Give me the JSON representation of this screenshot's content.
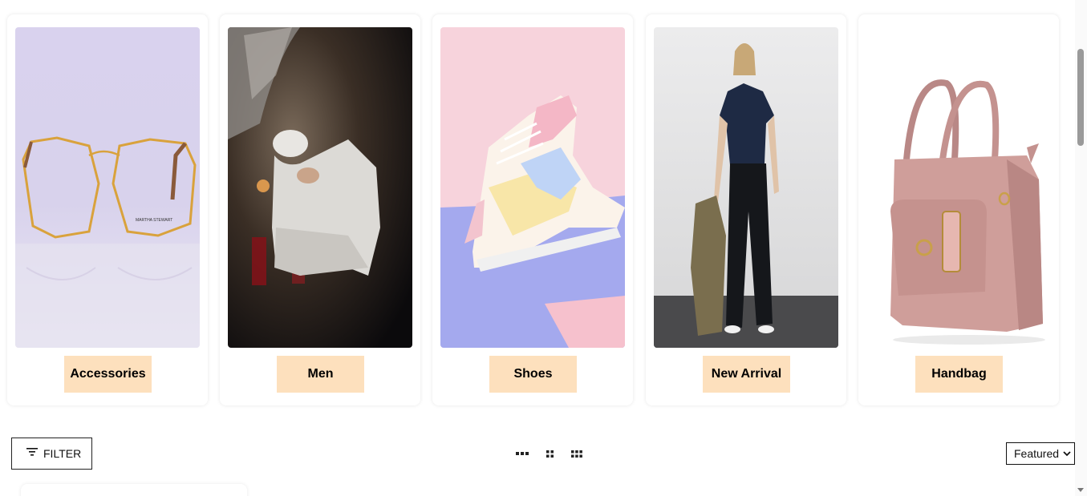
{
  "categories": [
    {
      "label": "Accessories"
    },
    {
      "label": "Men"
    },
    {
      "label": "Shoes"
    },
    {
      "label": "New Arrival"
    },
    {
      "label": "Handbag"
    }
  ],
  "toolbar": {
    "filter_label": "FILTER",
    "sort_selected": "Featured",
    "view_options": [
      "list-view-icon",
      "grid-2-icon",
      "grid-3-icon"
    ]
  },
  "colors": {
    "tag_background": "#fde0bd",
    "border": "#222222"
  }
}
